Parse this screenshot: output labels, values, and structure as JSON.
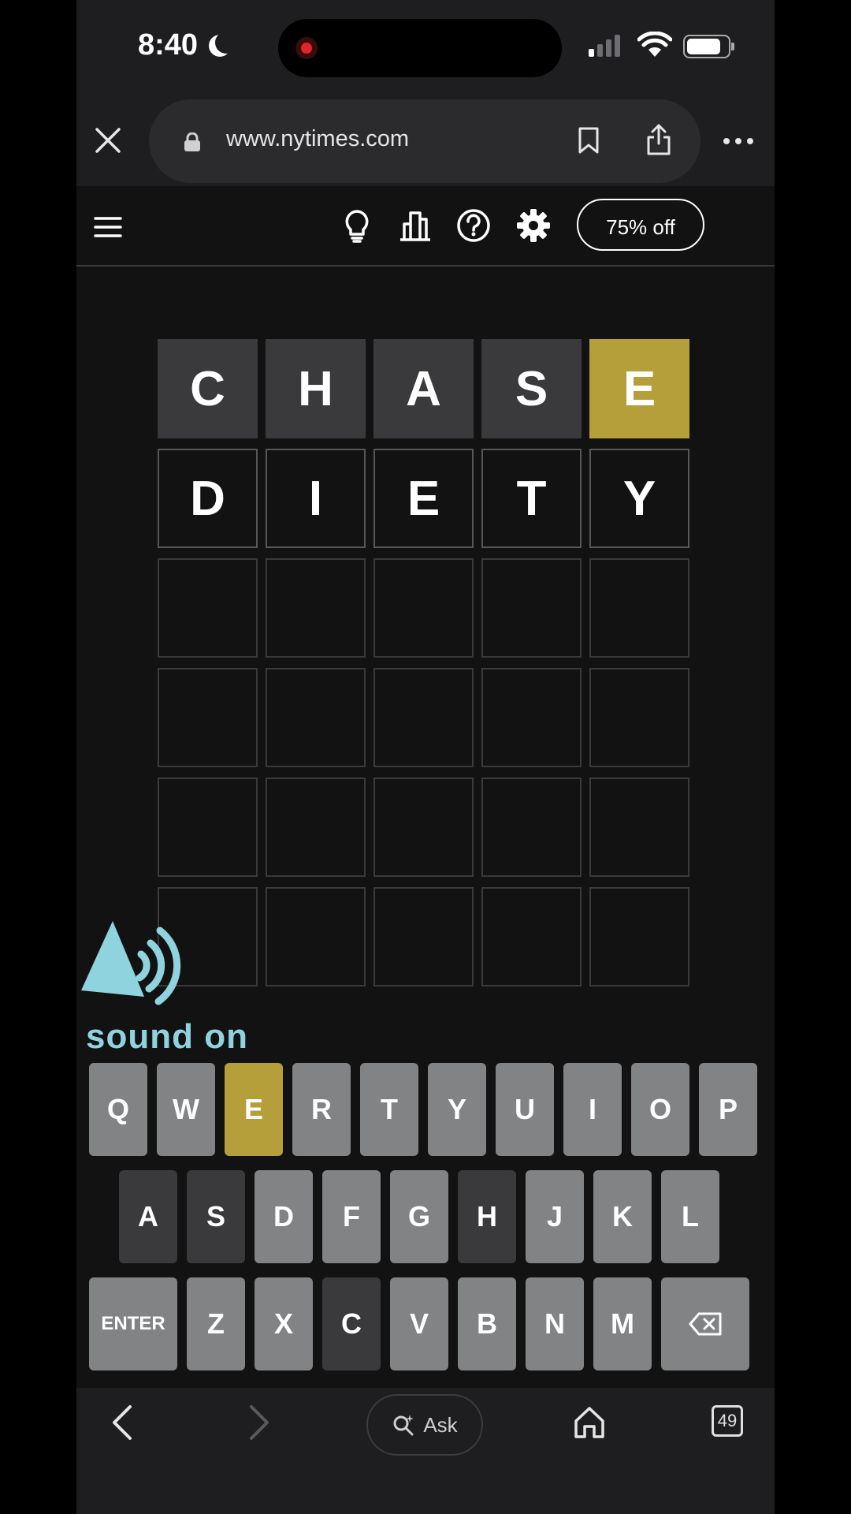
{
  "status_bar": {
    "time": "8:40"
  },
  "browser": {
    "url": "www.nytimes.com",
    "ask_label": "Ask",
    "tab_count": "49"
  },
  "header": {
    "promo_label": "75% off",
    "icons": [
      "menu-icon",
      "lightbulb-icon",
      "stats-icon",
      "help-icon",
      "settings-icon"
    ]
  },
  "board": {
    "rows": [
      [
        {
          "letter": "C",
          "state": "absent"
        },
        {
          "letter": "H",
          "state": "absent"
        },
        {
          "letter": "A",
          "state": "absent"
        },
        {
          "letter": "S",
          "state": "absent"
        },
        {
          "letter": "E",
          "state": "present"
        }
      ],
      [
        {
          "letter": "D",
          "state": "filled"
        },
        {
          "letter": "I",
          "state": "filled"
        },
        {
          "letter": "E",
          "state": "filled"
        },
        {
          "letter": "T",
          "state": "filled"
        },
        {
          "letter": "Y",
          "state": "filled"
        }
      ],
      [
        {
          "letter": "",
          "state": "empty"
        },
        {
          "letter": "",
          "state": "empty"
        },
        {
          "letter": "",
          "state": "empty"
        },
        {
          "letter": "",
          "state": "empty"
        },
        {
          "letter": "",
          "state": "empty"
        }
      ],
      [
        {
          "letter": "",
          "state": "empty"
        },
        {
          "letter": "",
          "state": "empty"
        },
        {
          "letter": "",
          "state": "empty"
        },
        {
          "letter": "",
          "state": "empty"
        },
        {
          "letter": "",
          "state": "empty"
        }
      ],
      [
        {
          "letter": "",
          "state": "empty"
        },
        {
          "letter": "",
          "state": "empty"
        },
        {
          "letter": "",
          "state": "empty"
        },
        {
          "letter": "",
          "state": "empty"
        },
        {
          "letter": "",
          "state": "empty"
        }
      ],
      [
        {
          "letter": "",
          "state": "empty"
        },
        {
          "letter": "",
          "state": "empty"
        },
        {
          "letter": "",
          "state": "empty"
        },
        {
          "letter": "",
          "state": "empty"
        },
        {
          "letter": "",
          "state": "empty"
        }
      ]
    ]
  },
  "overlay": {
    "sound_label": "sound on"
  },
  "keyboard": {
    "rows": [
      [
        {
          "key": "Q",
          "state": "unused"
        },
        {
          "key": "W",
          "state": "unused"
        },
        {
          "key": "E",
          "state": "present"
        },
        {
          "key": "R",
          "state": "unused"
        },
        {
          "key": "T",
          "state": "unused"
        },
        {
          "key": "Y",
          "state": "unused"
        },
        {
          "key": "U",
          "state": "unused"
        },
        {
          "key": "I",
          "state": "unused"
        },
        {
          "key": "O",
          "state": "unused"
        },
        {
          "key": "P",
          "state": "unused"
        }
      ],
      [
        {
          "key": "A",
          "state": "absent"
        },
        {
          "key": "S",
          "state": "absent"
        },
        {
          "key": "D",
          "state": "unused"
        },
        {
          "key": "F",
          "state": "unused"
        },
        {
          "key": "G",
          "state": "unused"
        },
        {
          "key": "H",
          "state": "absent"
        },
        {
          "key": "J",
          "state": "unused"
        },
        {
          "key": "K",
          "state": "unused"
        },
        {
          "key": "L",
          "state": "unused"
        }
      ],
      [
        {
          "key": "ENTER",
          "state": "wide"
        },
        {
          "key": "Z",
          "state": "unused"
        },
        {
          "key": "X",
          "state": "unused"
        },
        {
          "key": "C",
          "state": "absent"
        },
        {
          "key": "V",
          "state": "unused"
        },
        {
          "key": "B",
          "state": "unused"
        },
        {
          "key": "N",
          "state": "unused"
        },
        {
          "key": "M",
          "state": "unused"
        },
        {
          "key": "",
          "state": "backspace"
        }
      ]
    ]
  },
  "colors": {
    "present": "#b59f3b",
    "absent": "#3a3a3c",
    "unused": "#818384",
    "sound": "#8fd3df"
  }
}
